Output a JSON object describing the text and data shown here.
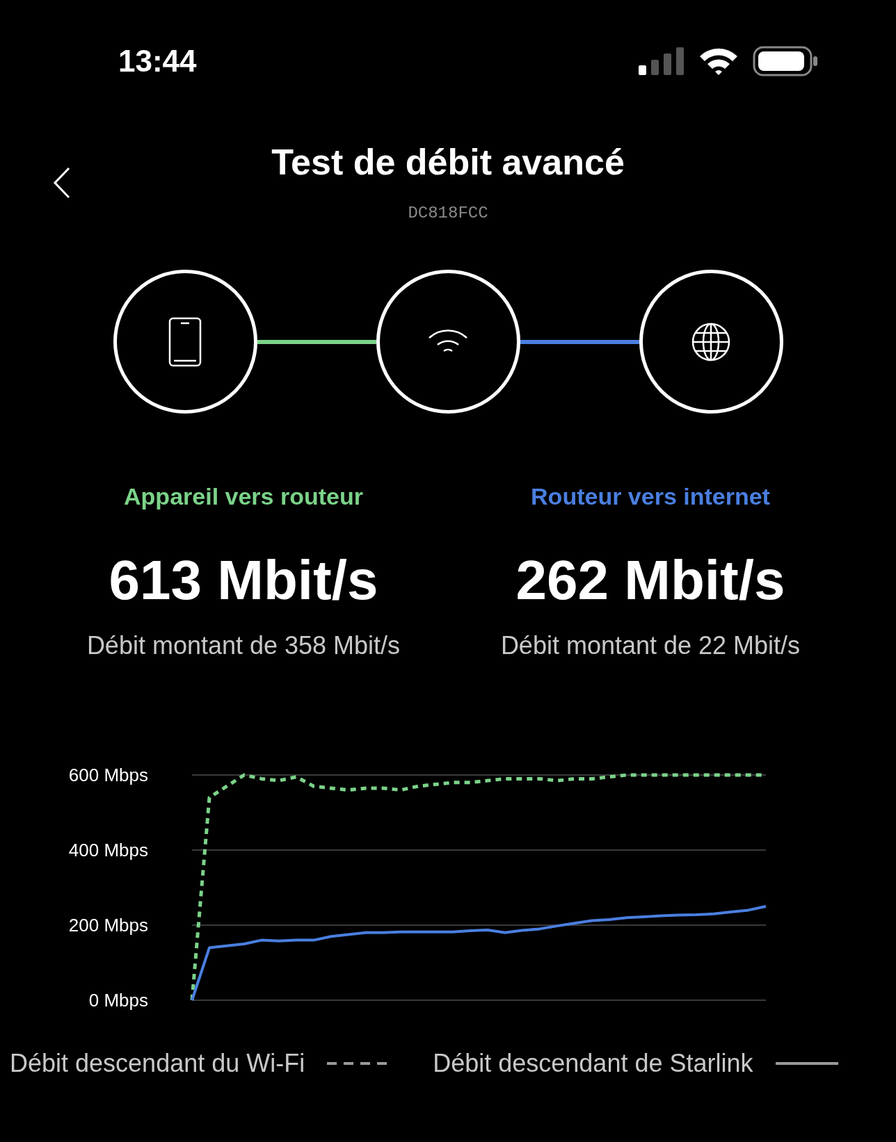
{
  "status_bar": {
    "time": "13:44"
  },
  "header": {
    "title": "Test de débit avancé",
    "subtitle": "DC818FCC"
  },
  "links": [
    {
      "color": "#7bd389"
    },
    {
      "color": "#4a7fe0"
    }
  ],
  "sections": [
    {
      "label": "Appareil vers routeur",
      "color": "#7bd389",
      "value": "613 Mbit/s",
      "detail": "Débit montant de 358 Mbit/s"
    },
    {
      "label": "Routeur vers internet",
      "color": "#4a7fe0",
      "value": "262 Mbit/s",
      "detail": "Débit montant de 22 Mbit/s"
    }
  ],
  "chart": {
    "chart_data": {
      "type": "line",
      "grid": true,
      "ylim": [
        0,
        600
      ],
      "yticks": [
        {
          "value": 0,
          "label": "0 Mbps"
        },
        {
          "value": 200,
          "label": "200 Mbps"
        },
        {
          "value": 400,
          "label": "400 Mbps"
        },
        {
          "value": 600,
          "label": "600 Mbps"
        }
      ],
      "series": [
        {
          "name": "Débit descendant du Wi-Fi",
          "color": "#7bd389",
          "line_style": "dashed",
          "values": [
            0,
            540,
            570,
            600,
            590,
            585,
            595,
            570,
            565,
            560,
            565,
            565,
            560,
            570,
            575,
            580,
            580,
            585,
            590,
            590,
            590,
            585,
            590,
            590,
            595,
            600,
            600,
            600,
            600,
            600,
            600,
            600,
            600,
            600
          ]
        },
        {
          "name": "Débit descendant de Starlink",
          "color": "#4a7fe0",
          "line_style": "solid",
          "values": [
            0,
            140,
            145,
            150,
            160,
            158,
            160,
            160,
            170,
            175,
            180,
            180,
            182,
            182,
            182,
            182,
            185,
            187,
            180,
            186,
            190,
            198,
            205,
            212,
            215,
            220,
            222,
            225,
            227,
            228,
            230,
            235,
            240,
            250
          ]
        }
      ]
    }
  }
}
